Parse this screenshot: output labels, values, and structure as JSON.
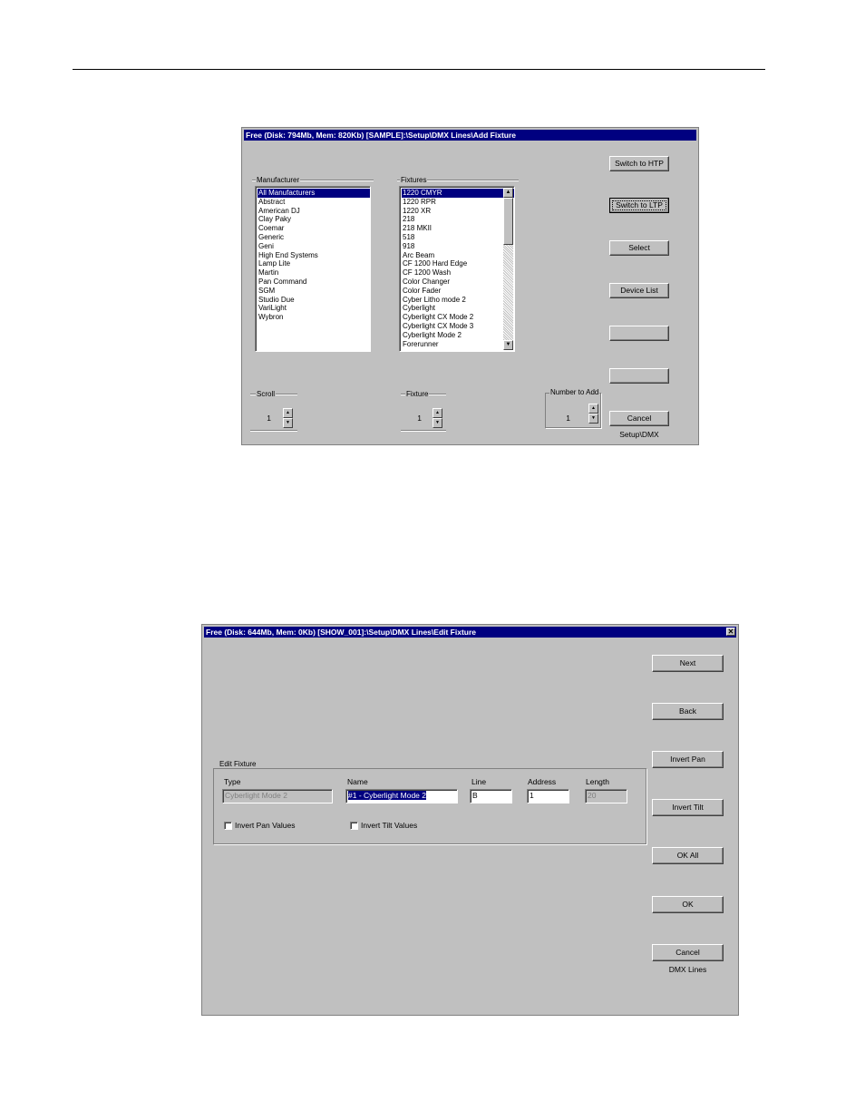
{
  "window1": {
    "title": "Free (Disk: 794Mb, Mem: 820Kb)    [SAMPLE]:\\Setup\\DMX Lines\\Add Fixture",
    "manufacturer_label": "Manufacturer",
    "manufacturers": [
      "All Manufacturers",
      "Abstract",
      "American DJ",
      "Clay Paky",
      "Coemar",
      "Generic",
      "Geni",
      "High End Systems",
      "Lamp Lite",
      "Martin",
      "Pan Command",
      "SGM",
      "Studio Due",
      "VariLight",
      "Wybron"
    ],
    "fixtures_label": "Fixtures",
    "fixtures": [
      "1220 CMYR",
      "1220 RPR",
      "1220 XR",
      "218",
      "218 MKII",
      "518",
      "918",
      "Arc Beam",
      "CF 1200 Hard Edge",
      "CF 1200 Wash",
      "Color Changer",
      "Color Fader",
      "Cyber Litho mode 2",
      "Cyberlight",
      "Cyberlight CX Mode 2",
      "Cyberlight CX Mode 3",
      "Cyberlight Mode 2",
      "Forerunner"
    ],
    "scroll_label": "Scroll",
    "scroll_value": "1",
    "fixture_label": "Fixture",
    "fixture_value": "1",
    "number_to_add_label": "Number to Add",
    "number_to_add_value": "1",
    "buttons": {
      "switch_htp": "Switch to HTP",
      "switch_ltp": "Switch to LTP",
      "select": "Select",
      "device_list": "Device List",
      "blank1": "",
      "blank2": "",
      "cancel": "Cancel"
    },
    "footer": "Setup\\DMX"
  },
  "window2": {
    "title": "Free (Disk: 644Mb, Mem: 0Kb)    [SHOW_001]:\\Setup\\DMX Lines\\Edit Fixture",
    "close_glyph": "✕",
    "group_label": "Edit Fixture",
    "type_label": "Type",
    "type_value": "Cyberlight Mode 2",
    "name_label": "Name",
    "name_value": "#1 - Cyberlight Mode 2",
    "line_label": "Line",
    "line_value": "B",
    "address_label": "Address",
    "address_value": "1",
    "length_label": "Length",
    "length_value": "20",
    "invert_pan_values": "Invert Pan Values",
    "invert_tilt_values": "Invert Tilt Values",
    "buttons": {
      "next": "Next",
      "back": "Back",
      "invert_pan": "Invert Pan",
      "invert_tilt": "Invert Tilt",
      "ok_all": "OK All",
      "ok": "OK",
      "cancel": "Cancel"
    },
    "footer": "DMX Lines"
  }
}
